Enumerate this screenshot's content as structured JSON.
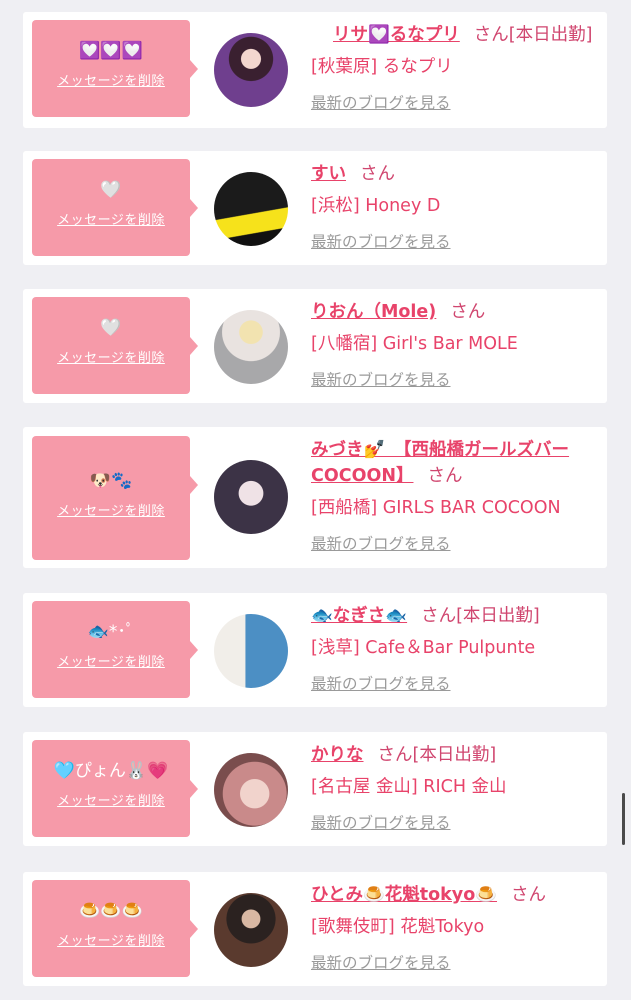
{
  "delete_label": "メッセージを削除",
  "blog_label": "最新のブログを見る",
  "san": "さん",
  "today_badge": "[本日出勤]",
  "accent_color": "#f69aa9",
  "name_color": "#e8436a",
  "entries": [
    {
      "emoji": "💟💟💟",
      "name": "リサ💟るなプリ",
      "today": "[本日出勤]",
      "shop": "[秋葉原] るなプリ",
      "avatar": "girl-avatar-purple"
    },
    {
      "emoji": "🤍",
      "name": "すい",
      "today": "",
      "shop": "[浜松] Honey D",
      "avatar": "girl-avatar-yellow"
    },
    {
      "emoji": "🤍",
      "name": "りおん（Mole)",
      "today": "",
      "shop": "[八幡宿] Girl's Bar MOLE",
      "avatar": "girl-avatar-bow"
    },
    {
      "emoji": "🐶🐾",
      "name": "みづき💅　【西船橋ガールズバーCOCOON】",
      "today": "",
      "shop": "[西船橋] GIRLS BAR COCOON",
      "avatar": "girl-avatar-dark"
    },
    {
      "emoji": "🐟*･ﾟ",
      "name": "🐟なぎさ🐟",
      "today": "[本日出勤]",
      "shop": "[浅草] Cafe＆Bar Pulpunte",
      "avatar": "girl-avatar-cafe"
    },
    {
      "emoji": "🩵ぴょん🐰💗",
      "name": "かりな",
      "today": "[本日出勤]",
      "shop": "[名古屋 金山] RICH 金山",
      "avatar": "girl-avatar-pink"
    },
    {
      "emoji": "🍮🍮🍮",
      "name": "ひとみ🍮花魁tokyo🍮",
      "today": "",
      "shop": "[歌舞伎町] 花魁Tokyo",
      "avatar": "girl-avatar-kimono"
    }
  ]
}
